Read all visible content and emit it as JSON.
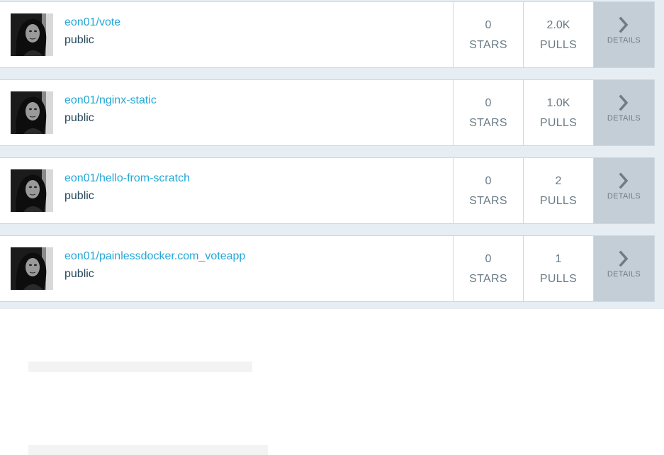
{
  "repositories": [
    {
      "name": "eon01/vote",
      "visibility": "public",
      "stars": "0",
      "stars_label": "STARS",
      "pulls": "2.0K",
      "pulls_label": "PULLS",
      "details_label": "DETAILS"
    },
    {
      "name": "eon01/nginx-static",
      "visibility": "public",
      "stars": "0",
      "stars_label": "STARS",
      "pulls": "1.0K",
      "pulls_label": "PULLS",
      "details_label": "DETAILS"
    },
    {
      "name": "eon01/hello-from-scratch",
      "visibility": "public",
      "stars": "0",
      "stars_label": "STARS",
      "pulls": "2",
      "pulls_label": "PULLS",
      "details_label": "DETAILS"
    },
    {
      "name": "eon01/painlessdocker.com_voteapp",
      "visibility": "public",
      "stars": "0",
      "stars_label": "STARS",
      "pulls": "1",
      "pulls_label": "PULLS",
      "details_label": "DETAILS"
    }
  ],
  "icons": {
    "avatar": "user-avatar",
    "details": "chevron-right-icon"
  },
  "colors": {
    "link": "#22a7d8",
    "details_bg": "#c4ced6",
    "list_bg": "#e6edf3"
  }
}
